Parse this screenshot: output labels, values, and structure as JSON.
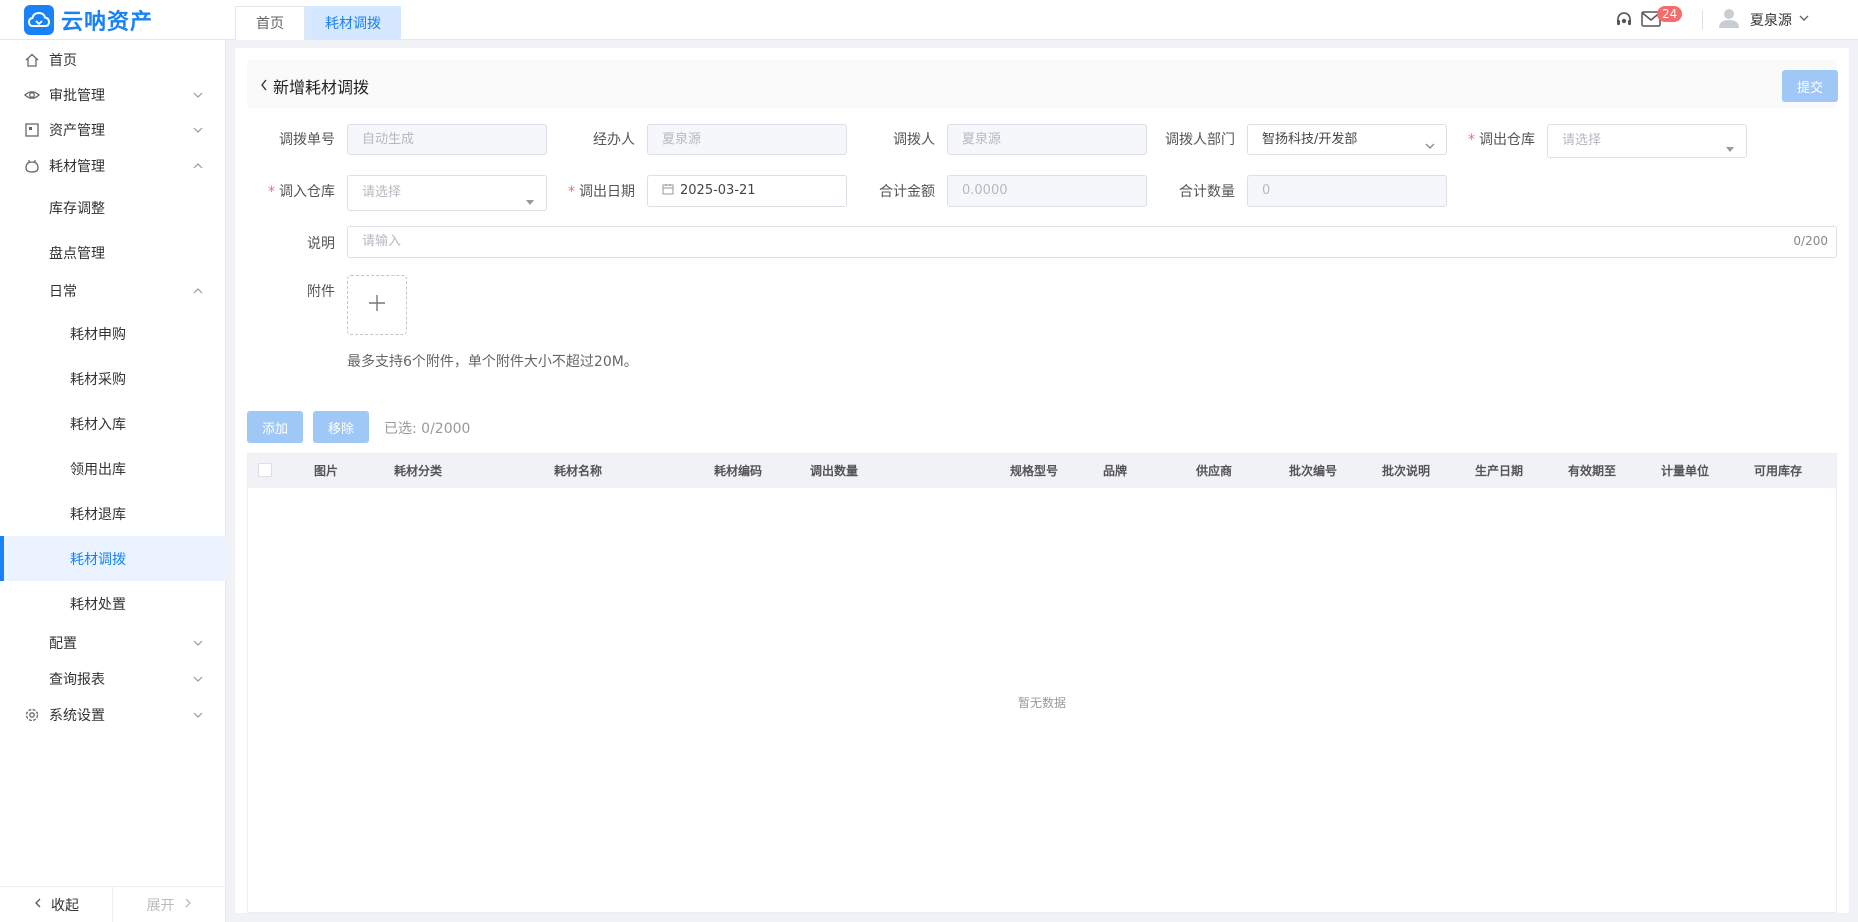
{
  "app": {
    "name": "云呐资产",
    "brand_color": "#1a82f7"
  },
  "tabs": [
    {
      "label": "首页"
    },
    {
      "label": "耗材调拨"
    }
  ],
  "header": {
    "mail_badge": "24",
    "user_name": "夏泉源"
  },
  "sidebar": {
    "items": [
      {
        "label": "首页",
        "icon": "home-icon"
      },
      {
        "label": "审批管理",
        "icon": "eye-icon"
      },
      {
        "label": "资产管理",
        "icon": "asset-icon"
      },
      {
        "label": "耗材管理",
        "icon": "consumable-icon"
      },
      {
        "label": "库存调整"
      },
      {
        "label": "盘点管理"
      },
      {
        "label": "日常"
      },
      {
        "label": "耗材申购"
      },
      {
        "label": "耗材采购"
      },
      {
        "label": "耗材入库"
      },
      {
        "label": "领用出库"
      },
      {
        "label": "耗材退库"
      },
      {
        "label": "耗材调拨"
      },
      {
        "label": "耗材处置"
      },
      {
        "label": "配置"
      },
      {
        "label": "查询报表"
      },
      {
        "label": "系统设置",
        "icon": "settings-icon"
      }
    ],
    "collapse": "收起",
    "expand": "展开"
  },
  "page": {
    "title": "新增耗材调拨",
    "submit": "提交"
  },
  "form": {
    "transfer_no": {
      "label": "调拨单号",
      "value": "自动生成"
    },
    "handler": {
      "label": "经办人",
      "value": "夏泉源"
    },
    "transferor": {
      "label": "调拨人",
      "value": "夏泉源"
    },
    "dept": {
      "label": "调拨人部门",
      "value": "智扬科技/开发部"
    },
    "out_wh": {
      "label": "调出仓库",
      "placeholder": "请选择"
    },
    "in_wh": {
      "label": "调入仓库",
      "placeholder": "请选择"
    },
    "out_date": {
      "label": "调出日期",
      "value": "2025-03-21"
    },
    "total_amount": {
      "label": "合计金额",
      "value": "0.0000"
    },
    "total_qty": {
      "label": "合计数量",
      "value": "0"
    },
    "desc": {
      "label": "说明",
      "placeholder": "请输入",
      "counter": "0/200"
    },
    "attach": {
      "label": "附件",
      "hint": "最多支持6个附件，单个附件大小不超过20M。"
    }
  },
  "toolbar": {
    "add": "添加",
    "remove": "移除",
    "selected": "已选: 0/2000"
  },
  "table": {
    "columns": [
      "图片",
      "耗材分类",
      "耗材名称",
      "耗材编码",
      "调出数量",
      "规格型号",
      "品牌",
      "供应商",
      "批次编号",
      "批次说明",
      "生产日期",
      "有效期至",
      "计量单位",
      "可用库存"
    ],
    "empty_text": "暂无数据"
  }
}
